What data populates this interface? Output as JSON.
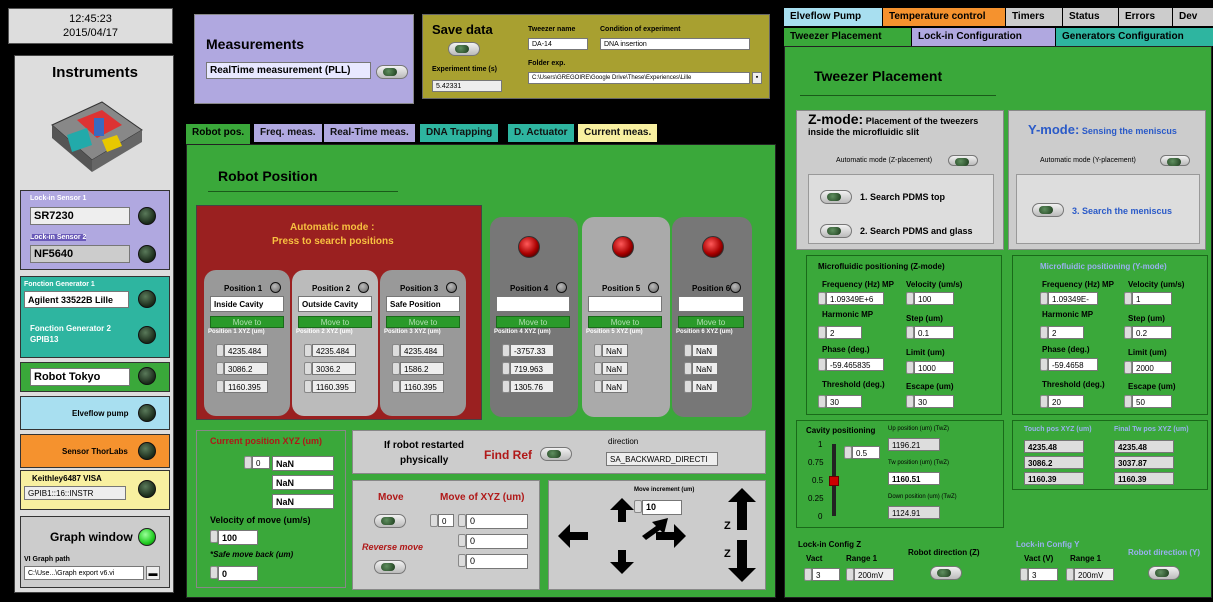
{
  "clock": {
    "time": "12:45:23",
    "date": "2015/04/17"
  },
  "instruments": {
    "title": "Instruments",
    "lockin1_label": "Lock-in Sensor 1",
    "lockin1_value": "SR7230",
    "lockin2_label": "Lock-in Sensor 2",
    "lockin2_value": "NF5640",
    "fg1_label": "Fonction Generator 1",
    "fg1_value": "Agilent 33522B Lille",
    "fg2_label": "Fonction Generator 2",
    "fg2_sub": "GPIB13",
    "robot_value": "Robot Tokyo",
    "elveflow_label": "Elveflow pump",
    "thorlabs_label": "Sensor ThorLabs",
    "keithley_label": "Keithley6487 VISA",
    "keithley_value": "GPIB1::16::INSTR",
    "graph_label": "Graph window",
    "graph_path_label": "VI Graph path",
    "graph_path": "C:\\Use...\\Graph export v6.vi"
  },
  "measurements": {
    "title": "Measurements",
    "mode": "RealTime measurement (PLL)"
  },
  "save": {
    "title": "Save data",
    "tweezer_label": "Tweezer name",
    "tweezer_value": "DA-14",
    "condition_label": "Condition of experiment",
    "condition_value": "DNA insertion",
    "exptime_label": "Experiment time (s)",
    "exptime_value": "5.42331",
    "folder_label": "Folder exp.",
    "folder_value": "C:\\Users\\GREGOIRE\\Google Drive\\These\\Experiences\\Lille"
  },
  "tabs": [
    {
      "label": "Robot pos."
    },
    {
      "label": "Freq. meas."
    },
    {
      "label": "Real-Time meas."
    },
    {
      "label": "DNA Trapping"
    },
    {
      "label": "D. Actuator"
    },
    {
      "label": "Current meas."
    }
  ],
  "robot": {
    "title": "Robot Position",
    "auto_line1": "Automatic mode :",
    "auto_line2": "Press to search positions",
    "move_to": "Move to",
    "positions": [
      {
        "label": "Position 1",
        "name": "Inside Cavity",
        "xyz_label": "Position 1 XYZ (um)",
        "x": "4235.484",
        "y": "3086.2",
        "z": "1160.395"
      },
      {
        "label": "Position 2",
        "name": "Outside Cavity",
        "xyz_label": "Position 2 XYZ (um)",
        "x": "4235.484",
        "y": "3036.2",
        "z": "1160.395"
      },
      {
        "label": "Position 3",
        "name": "Safe Position",
        "xyz_label": "Position 3 XYZ (um)",
        "x": "4235.484",
        "y": "1586.2",
        "z": "1160.395"
      },
      {
        "label": "Position 4",
        "name": "",
        "xyz_label": "Position 4 XYZ (um)",
        "x": "-3757.33",
        "y": "719.963",
        "z": "1305.76"
      },
      {
        "label": "Position 5",
        "name": "",
        "xyz_label": "Position 5 XYZ (um)",
        "x": "NaN",
        "y": "NaN",
        "z": "NaN"
      },
      {
        "label": "Position 6",
        "name": "",
        "xyz_label": "Position 6 XYZ (um)",
        "x": "NaN",
        "y": "NaN",
        "z": "NaN"
      }
    ],
    "current_label": "Current position XYZ (um)",
    "current_index": "0",
    "current_x": "NaN",
    "current_y": "NaN",
    "current_z": "NaN",
    "velocity_label": "Velocity of move (um/s)",
    "velocity": "100",
    "safe_label": "*Safe move back (um)",
    "safe": "0",
    "restart_line1": "If robot restarted",
    "restart_line2": "physically",
    "findref": "Find Ref",
    "direction_label": "direction",
    "direction": "SA_BACKWARD_DIRECTI",
    "move": "Move",
    "reverse": "Reverse move",
    "movexyz_label": "Move of XYZ (um)",
    "move_index": "0",
    "move_x": "0",
    "move_y": "0",
    "move_z": "0",
    "increment_label": "Move increment (um)",
    "increment": "10",
    "z_up": "Z",
    "z_down": "Z"
  },
  "right_tabs_row1": [
    {
      "label": "Elveflow Pump"
    },
    {
      "label": "Temperature control"
    },
    {
      "label": "Timers"
    },
    {
      "label": "Status"
    },
    {
      "label": "Errors"
    },
    {
      "label": "Dev"
    }
  ],
  "right_tabs_row2": [
    {
      "label": "Tweezer Placement"
    },
    {
      "label": "Lock-in Configuration"
    },
    {
      "label": "Generators Configuration"
    }
  ],
  "tweezer": {
    "title": "Tweezer Placement",
    "z_title_big": "Z-mode:",
    "z_title_rest": "Placement of the tweezers",
    "z_title_line2": "inside the microfluidic slit",
    "z_auto": "Automatic mode (Z-placement)",
    "z_btn1": "1. Search PDMS top",
    "z_btn2": "2. Search PDMS and glass",
    "y_title_big": "Y-mode:",
    "y_title_rest": "Sensing the meniscus",
    "y_auto": "Automatic mode (Y-placement)",
    "y_btn3": "3. Search the meniscus",
    "zpos_title": "Microfluidic positioning (Z-mode)",
    "ypos_title": "Microfluidic positioning (Y-mode)",
    "freq_label": "Frequency (Hz) MP",
    "freq_z": "1.09349E+6",
    "freq_y": "1.09349E-",
    "vel_label": "Velocity (um/s)",
    "vel_z": "100",
    "vel_y": "1",
    "harm_label": "Harmonic MP",
    "harm_z": "2",
    "harm_y": "2",
    "step_label": "Step (um)",
    "step_z": "0.1",
    "step_y": "0.2",
    "phase_label": "Phase (deg.)",
    "phase_z": "-59.465835",
    "phase_y": "-59.4658",
    "limit_label": "Limit (um)",
    "limit_z": "1000",
    "limit_y": "2000",
    "thr_label": "Threshold (deg.)",
    "thr_z": "30",
    "thr_y": "20",
    "esc_label": "Escape (um)",
    "esc_z": "30",
    "esc_y": "50",
    "cavity_label": "Cavity positioning",
    "cavity_value": "0.5",
    "cavity_ticks": [
      "1",
      "0.75",
      "0.5",
      "0.25",
      "0"
    ],
    "up_label": "Up position (um) (TwZ)",
    "up_value": "1196.21",
    "tw_label": "Tw position (um) (TwZ)",
    "tw_value": "1160.51",
    "down_label": "Down position (um) (TwZ)",
    "down_value": "1124.91",
    "touch_label": "Touch pos XYZ (um)",
    "touch": [
      "4235.48",
      "3086.2",
      "1160.39"
    ],
    "final_label": "Final Tw pos XYZ (um)",
    "final": [
      "4235.48",
      "3037.87",
      "1160.39"
    ],
    "lockz_title": "Lock-in Config Z",
    "vact_label": "Vact",
    "range_label": "Range 1",
    "vact_z": "3",
    "range_z": "200mV",
    "dirz_label": "Robot direction (Z)",
    "locky_title": "Lock-in Config Y",
    "vact_y_label": "Vact (V)",
    "vact_y": "3",
    "range_y": "200mV",
    "diry_label": "Robot direction (Y)"
  }
}
